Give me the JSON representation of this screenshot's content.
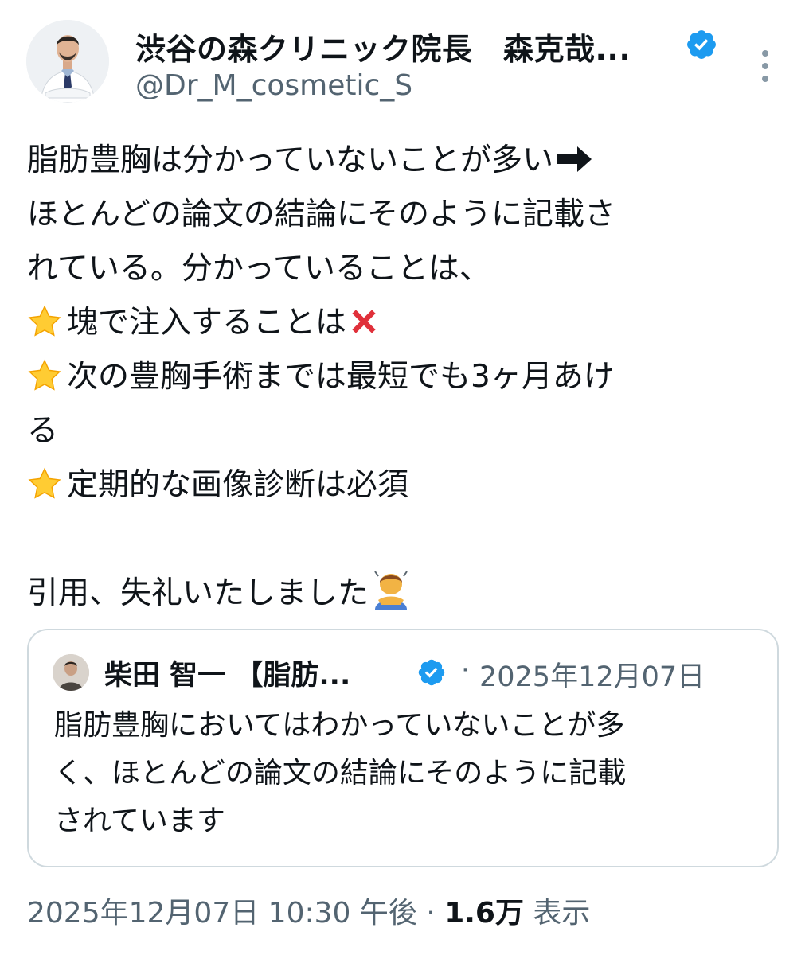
{
  "author": {
    "display_name": "渋谷の森クリニック院長　森克哉...",
    "handle": "@Dr_M_cosmetic_S",
    "verified_icon": "verified-badge-icon",
    "accent_color": "#1d9bf0"
  },
  "tweet": {
    "lines": [
      "脂肪豊胸は分かっていないことが多い",
      "ほとんどの論文の結論にそのように記載さ",
      "れている。分かっていることは、",
      "塊で注入することは",
      "次の豊胸手術までは最短でも3ヶ月あけ",
      "る",
      "定期的な画像診断は必須",
      "引用、失礼いたしました"
    ]
  },
  "quoted": {
    "display_name": "柴田 智一 【脂肪...",
    "separator": "·",
    "date": "2025年12月07日",
    "lines": [
      "脂肪豊胸においてはわかっていないことが多",
      "く、ほとんどの論文の結論にそのように記載",
      "されています"
    ]
  },
  "meta": {
    "datetime": "2025年12月07日 10:30 午後 · ",
    "views_count": "1.6万",
    "views_label": " 表示"
  }
}
